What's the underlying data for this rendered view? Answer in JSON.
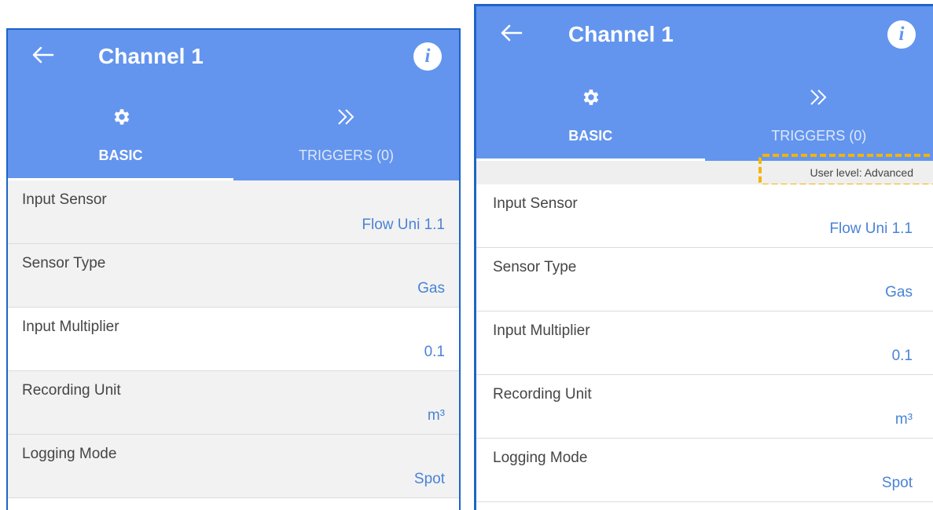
{
  "screens": [
    {
      "title": "Channel 1",
      "tabs": {
        "basic": "BASIC",
        "triggers": "TRIGGERS (0)"
      },
      "rows": [
        {
          "label": "Input Sensor",
          "value": "Flow Uni 1.1"
        },
        {
          "label": "Sensor Type",
          "value": "Gas"
        },
        {
          "label": "Input Multiplier",
          "value": "0.1"
        },
        {
          "label": "Recording Unit",
          "value": "m³"
        },
        {
          "label": "Logging Mode",
          "value": "Spot"
        }
      ]
    },
    {
      "title": "Channel 1",
      "tabs": {
        "basic": "BASIC",
        "triggers": "TRIGGERS (0)"
      },
      "banner": "User level: Advanced",
      "rows": [
        {
          "label": "Input Sensor",
          "value": "Flow Uni 1.1"
        },
        {
          "label": "Sensor Type",
          "value": "Gas"
        },
        {
          "label": "Input Multiplier",
          "value": "0.1"
        },
        {
          "label": "Recording Unit",
          "value": "m³"
        },
        {
          "label": "Logging Mode",
          "value": "Spot"
        }
      ]
    }
  ],
  "icons": {
    "back": "back-arrow-icon",
    "info": "info-icon",
    "basic_tab": "gear-icon",
    "triggers_tab": "double-chevron-right-icon"
  },
  "colors": {
    "appbar": "#6395ee",
    "value_text": "#4a83d6",
    "highlight": "#f4b400",
    "frame": "#1e64c8"
  }
}
